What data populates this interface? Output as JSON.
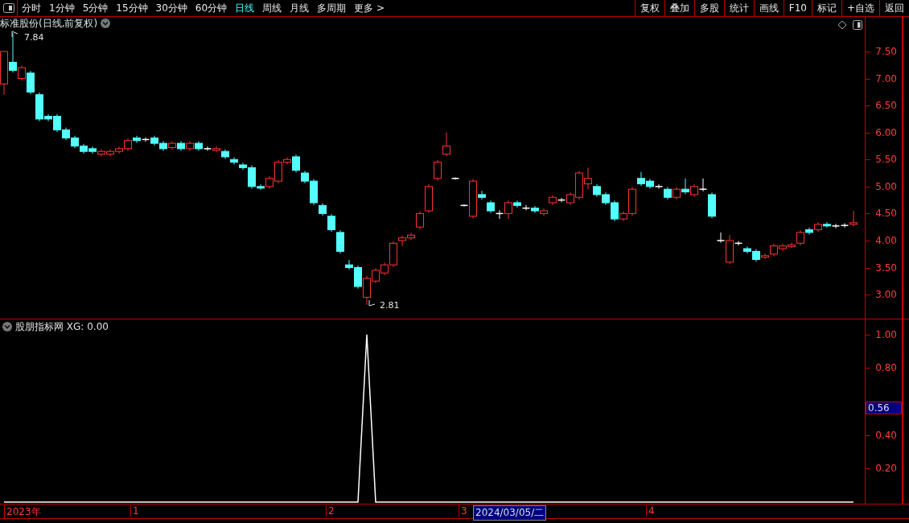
{
  "toolbar": {
    "period_tabs": [
      {
        "label": "分时",
        "selected": false
      },
      {
        "label": "1分钟",
        "selected": false
      },
      {
        "label": "5分钟",
        "selected": false
      },
      {
        "label": "15分钟",
        "selected": false
      },
      {
        "label": "30分钟",
        "selected": false
      },
      {
        "label": "60分钟",
        "selected": false
      },
      {
        "label": "日线",
        "selected": true
      },
      {
        "label": "周线",
        "selected": false
      },
      {
        "label": "月线",
        "selected": false
      },
      {
        "label": "多周期",
        "selected": false
      },
      {
        "label": "更多 >",
        "selected": false
      }
    ],
    "actions": [
      "复权",
      "叠加",
      "多股",
      "统计",
      "画线",
      "F10",
      "标记",
      "+自选",
      "返回"
    ]
  },
  "main_chart": {
    "title": "标准股份(日线,前复权)",
    "high_label": "7.84",
    "low_label": "2.81",
    "chart_data": {
      "type": "candlestick",
      "ylim": [
        2.54,
        8.14
      ],
      "yticks": [
        {
          "value": 7.5,
          "label": "7.50"
        },
        {
          "value": 7.0,
          "label": "7.00"
        },
        {
          "value": 6.5,
          "label": "6.50"
        },
        {
          "value": 6.0,
          "label": "6.00"
        },
        {
          "value": 5.5,
          "label": "5.50"
        },
        {
          "value": 5.0,
          "label": "5.00"
        },
        {
          "value": 4.5,
          "label": "4.50"
        },
        {
          "value": 4.0,
          "label": "4.00"
        },
        {
          "value": 3.5,
          "label": "3.50"
        },
        {
          "value": 3.0,
          "label": "3.00"
        }
      ],
      "ohlc": [
        [
          6.9,
          7.5,
          6.7,
          7.5
        ],
        [
          7.3,
          7.84,
          7.11,
          7.15
        ],
        [
          7.0,
          7.24,
          6.96,
          7.2
        ],
        [
          7.1,
          7.14,
          6.71,
          6.75
        ],
        [
          6.7,
          6.74,
          6.21,
          6.25
        ],
        [
          6.3,
          6.34,
          6.21,
          6.25
        ],
        [
          6.3,
          6.34,
          6.01,
          6.05
        ],
        [
          6.05,
          6.09,
          5.86,
          5.9
        ],
        [
          5.9,
          5.94,
          5.71,
          5.75
        ],
        [
          5.75,
          5.79,
          5.61,
          5.65
        ],
        [
          5.7,
          5.74,
          5.61,
          5.65
        ],
        [
          5.6,
          5.69,
          5.56,
          5.65
        ],
        [
          5.6,
          5.69,
          5.56,
          5.65
        ],
        [
          5.65,
          5.74,
          5.61,
          5.7
        ],
        [
          5.7,
          5.89,
          5.66,
          5.85
        ],
        [
          5.9,
          5.94,
          5.81,
          5.85
        ],
        [
          5.87,
          5.91,
          5.83,
          5.87
        ],
        [
          5.9,
          5.94,
          5.76,
          5.8
        ],
        [
          5.8,
          5.84,
          5.66,
          5.7
        ],
        [
          5.72,
          5.84,
          5.68,
          5.8
        ],
        [
          5.8,
          5.84,
          5.66,
          5.7
        ],
        [
          5.7,
          5.84,
          5.66,
          5.8
        ],
        [
          5.8,
          5.84,
          5.66,
          5.7
        ],
        [
          5.7,
          5.74,
          5.66,
          5.7
        ],
        [
          5.68,
          5.74,
          5.64,
          5.7
        ],
        [
          5.65,
          5.69,
          5.51,
          5.55
        ],
        [
          5.5,
          5.54,
          5.41,
          5.45
        ],
        [
          5.4,
          5.44,
          5.31,
          5.35
        ],
        [
          5.35,
          5.39,
          4.96,
          5.0
        ],
        [
          5.0,
          5.04,
          4.94,
          4.98
        ],
        [
          5.0,
          5.19,
          4.96,
          5.15
        ],
        [
          5.1,
          5.49,
          5.06,
          5.45
        ],
        [
          5.45,
          5.54,
          5.41,
          5.5
        ],
        [
          5.55,
          5.59,
          5.26,
          5.3
        ],
        [
          5.25,
          5.29,
          5.06,
          5.1
        ],
        [
          5.1,
          5.14,
          4.66,
          4.7
        ],
        [
          4.65,
          4.69,
          4.46,
          4.5
        ],
        [
          4.45,
          4.49,
          4.16,
          4.2
        ],
        [
          4.15,
          4.19,
          3.76,
          3.8
        ],
        [
          3.55,
          3.64,
          3.46,
          3.5
        ],
        [
          3.5,
          3.54,
          3.11,
          3.15
        ],
        [
          2.95,
          3.35,
          2.81,
          3.3
        ],
        [
          3.25,
          3.49,
          3.21,
          3.45
        ],
        [
          3.4,
          3.59,
          3.36,
          3.55
        ],
        [
          3.55,
          3.99,
          3.51,
          3.95
        ],
        [
          4.0,
          4.09,
          3.9,
          4.05
        ],
        [
          4.05,
          4.14,
          4.01,
          4.1
        ],
        [
          4.25,
          4.54,
          4.21,
          4.5
        ],
        [
          4.55,
          5.04,
          4.51,
          5.0
        ],
        [
          5.15,
          5.49,
          5.11,
          5.45
        ],
        [
          5.6,
          6.0,
          5.56,
          5.75
        ],
        [
          5.15,
          5.17,
          5.13,
          5.15
        ],
        [
          4.65,
          4.67,
          4.63,
          4.65
        ],
        [
          4.45,
          5.14,
          4.41,
          5.1
        ],
        [
          4.85,
          4.92,
          4.76,
          4.8
        ],
        [
          4.7,
          4.74,
          4.51,
          4.55
        ],
        [
          4.5,
          4.56,
          4.4,
          4.5
        ],
        [
          4.5,
          4.74,
          4.4,
          4.7
        ],
        [
          4.7,
          4.74,
          4.61,
          4.65
        ],
        [
          4.6,
          4.66,
          4.56,
          4.6
        ],
        [
          4.6,
          4.64,
          4.51,
          4.55
        ],
        [
          4.5,
          4.59,
          4.46,
          4.55
        ],
        [
          4.7,
          4.84,
          4.66,
          4.8
        ],
        [
          4.75,
          4.79,
          4.71,
          4.75
        ],
        [
          4.7,
          4.89,
          4.66,
          4.85
        ],
        [
          4.8,
          5.29,
          4.76,
          5.25
        ],
        [
          5.05,
          5.35,
          4.95,
          5.15
        ],
        [
          5.0,
          5.04,
          4.81,
          4.85
        ],
        [
          4.85,
          4.89,
          4.66,
          4.7
        ],
        [
          4.7,
          4.74,
          4.36,
          4.4
        ],
        [
          4.4,
          4.54,
          4.36,
          4.5
        ],
        [
          4.5,
          4.99,
          4.46,
          4.95
        ],
        [
          5.15,
          5.27,
          5.01,
          5.05
        ],
        [
          5.1,
          5.14,
          4.96,
          5.0
        ],
        [
          5.0,
          5.04,
          4.96,
          5.0
        ],
        [
          4.95,
          4.99,
          4.76,
          4.8
        ],
        [
          4.8,
          4.99,
          4.76,
          4.95
        ],
        [
          4.95,
          5.15,
          4.86,
          4.9
        ],
        [
          4.85,
          5.04,
          4.81,
          5.0
        ],
        [
          4.95,
          5.15,
          4.91,
          4.95
        ],
        [
          4.85,
          4.89,
          4.41,
          4.45
        ],
        [
          4.0,
          4.15,
          3.96,
          4.0
        ],
        [
          3.6,
          4.1,
          3.56,
          4.0
        ],
        [
          3.95,
          3.99,
          3.91,
          3.95
        ],
        [
          3.85,
          3.89,
          3.76,
          3.8
        ],
        [
          3.8,
          3.84,
          3.61,
          3.65
        ],
        [
          3.7,
          3.76,
          3.66,
          3.72
        ],
        [
          3.75,
          3.94,
          3.71,
          3.9
        ],
        [
          3.85,
          3.94,
          3.81,
          3.9
        ],
        [
          3.9,
          3.96,
          3.86,
          3.92
        ],
        [
          3.95,
          4.19,
          3.91,
          4.15
        ],
        [
          4.2,
          4.24,
          4.11,
          4.15
        ],
        [
          4.2,
          4.34,
          4.16,
          4.3
        ],
        [
          4.3,
          4.34,
          4.24,
          4.28
        ],
        [
          4.27,
          4.31,
          4.23,
          4.27
        ],
        [
          4.28,
          4.32,
          4.24,
          4.28
        ],
        [
          4.3,
          4.55,
          4.26,
          4.33
        ]
      ]
    }
  },
  "indicator": {
    "title": "股朋指标网 XG: 0.00",
    "cursor_value": "0.56",
    "chart_data": {
      "type": "line",
      "ylim": [
        -0.015,
        1.09
      ],
      "yticks": [
        {
          "value": 0.2,
          "label": "0.20"
        },
        {
          "value": 0.4,
          "label": "0.40"
        },
        {
          "value": 0.8,
          "label": "0.80"
        },
        {
          "value": 1.0,
          "label": "1.00"
        }
      ],
      "series": [
        {
          "color": "#ffffff",
          "values": [
            0,
            0,
            0,
            0,
            0,
            0,
            0,
            0,
            0,
            0,
            0,
            0,
            0,
            0,
            0,
            0,
            0,
            0,
            0,
            0,
            0,
            0,
            0,
            0,
            0,
            0,
            0,
            0,
            0,
            0,
            0,
            0,
            0,
            0,
            0,
            0,
            0,
            0,
            0,
            0,
            0,
            1,
            0,
            0,
            0,
            0,
            0,
            0,
            0,
            0,
            0,
            0,
            0,
            0,
            0,
            0,
            0,
            0,
            0,
            0,
            0,
            0,
            0,
            0,
            0,
            0,
            0,
            0,
            0,
            0,
            0,
            0,
            0,
            0,
            0,
            0,
            0,
            0,
            0,
            0,
            0,
            0,
            0,
            0,
            0,
            0,
            0,
            0,
            0,
            0,
            0,
            0,
            0,
            0,
            0,
            0,
            0
          ]
        }
      ]
    }
  },
  "time_axis": {
    "labels": [
      "2023年",
      "1",
      "2",
      "3",
      "4"
    ],
    "cursor_date": "2024/03/05/二"
  }
}
